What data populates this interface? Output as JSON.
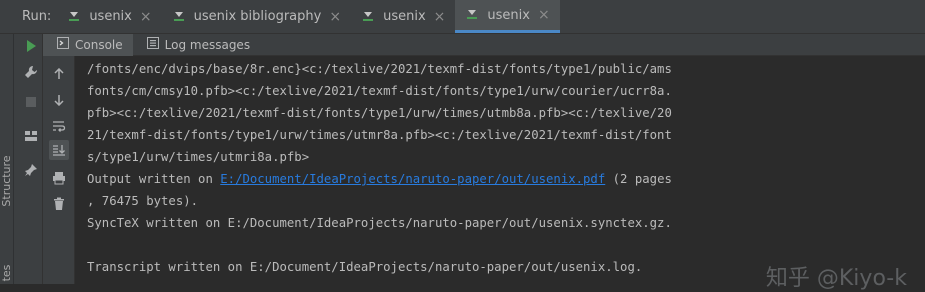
{
  "run_bar": {
    "label": "Run:",
    "tabs": [
      {
        "label": "usenix",
        "active": false
      },
      {
        "label": "usenix bibliography",
        "active": false
      },
      {
        "label": "usenix",
        "active": false
      },
      {
        "label": "usenix",
        "active": true
      }
    ]
  },
  "sub_tabs": [
    {
      "label": "Console",
      "active": true
    },
    {
      "label": "Log messages",
      "active": false
    }
  ],
  "side": {
    "structure_label": "Structure",
    "bottom_label": "tes"
  },
  "console": {
    "lines": [
      {
        "text": "/fonts/enc/dvips/base/8r.enc}<c:/texlive/2021/texmf-dist/fonts/type1/public/ams"
      },
      {
        "text": "fonts/cm/cmsy10.pfb><c:/texlive/2021/texmf-dist/fonts/type1/urw/courier/ucrr8a."
      },
      {
        "text": "pfb><c:/texlive/2021/texmf-dist/fonts/type1/urw/times/utmb8a.pfb><c:/texlive/20"
      },
      {
        "text": "21/texmf-dist/fonts/type1/urw/times/utmr8a.pfb><c:/texlive/2021/texmf-dist/font"
      },
      {
        "text": "s/type1/urw/times/utmri8a.pfb>"
      },
      {
        "prefix": "Output written on ",
        "link": "E:/Document/IdeaProjects/naruto-paper/out/usenix.pdf",
        "suffix": " (2 pages"
      },
      {
        "text": ", 76475 bytes)."
      },
      {
        "text": "SyncTeX written on E:/Document/IdeaProjects/naruto-paper/out/usenix.synctex.gz."
      },
      {
        "text": ""
      },
      {
        "text": "Transcript written on E:/Document/IdeaProjects/naruto-paper/out/usenix.log."
      }
    ]
  },
  "watermark": "知乎 @Kiyo-k",
  "colors": {
    "panel": "#3c3f41",
    "console_bg": "#2b2b2b",
    "text": "#bbbbbb",
    "link": "#287bde",
    "run_green": "#499c54"
  }
}
